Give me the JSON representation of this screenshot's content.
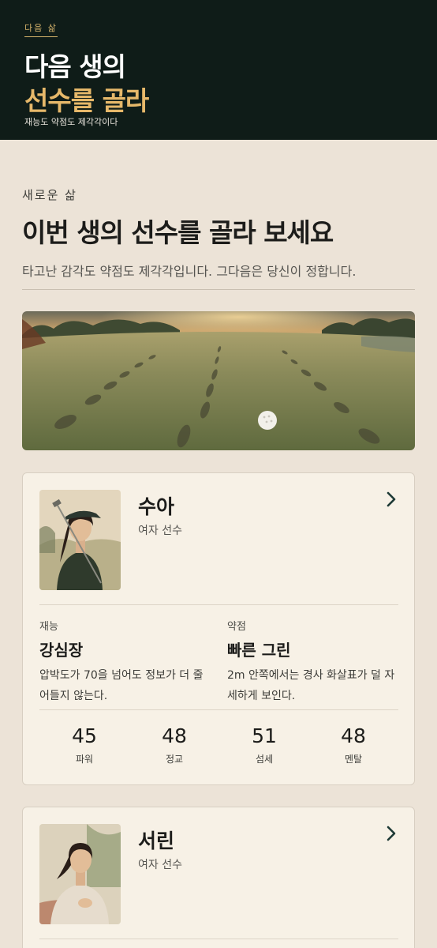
{
  "header": {
    "brand": "다음 삶",
    "title_line1": "다음 생의",
    "title_line2": "선수를 골라",
    "subtitle": "재능도 약점도 제각각이다"
  },
  "intro": {
    "eyebrow": "새로운 삶",
    "title": "이번 생의 선수를 골라 보세요",
    "description": "타고난 감각도 약점도 제각각입니다. 그다음은 당신이 정합니다."
  },
  "hero_image": {
    "icon": "golf-course-footprints-illustration"
  },
  "players": [
    {
      "name": "수아",
      "role": "여자 선수",
      "talent_label": "재능",
      "talent_title": "강심장",
      "talent_desc": "압박도가 70을 넘어도 정보가 더 줄어들지 않는다.",
      "weakness_label": "약점",
      "weakness_title": "빠른 그린",
      "weakness_desc": "2m 안쪽에서는 경사 화살표가 덜 자세하게 보인다.",
      "stats": [
        {
          "value": "45",
          "label": "파워"
        },
        {
          "value": "48",
          "label": "정교"
        },
        {
          "value": "51",
          "label": "섬세"
        },
        {
          "value": "48",
          "label": "멘탈"
        }
      ]
    },
    {
      "name": "서린",
      "role": "여자 선수"
    }
  ],
  "colors": {
    "header_bg": "#0f1c18",
    "accent_gold": "#e6b86a",
    "page_bg": "#ece3d7",
    "card_bg": "#f7f1e6"
  }
}
